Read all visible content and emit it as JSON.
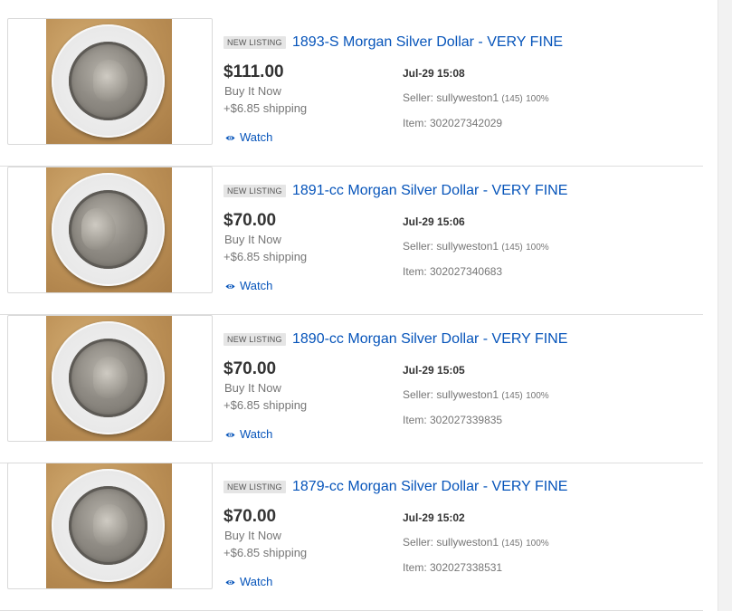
{
  "colors": {
    "link": "#0654ba",
    "price": "#333333",
    "muted": "#767676",
    "badge_bg": "#e5e5e5"
  },
  "watch_icon": "eye-icon",
  "listings": [
    {
      "badge": "NEW LISTING",
      "title": "1893-S Morgan Silver Dollar - VERY FINE",
      "price": "$111.00",
      "buy_type": "Buy It Now",
      "shipping": "+$6.85 shipping",
      "watch": "Watch",
      "date": "Jul-29 15:08",
      "seller_label": "Seller: sullyweston1",
      "seller_feedback": "(145)",
      "seller_percent": "100%",
      "item": "Item: 302027342029"
    },
    {
      "badge": "NEW LISTING",
      "title": "1891-cc Morgan Silver Dollar - VERY FINE",
      "price": "$70.00",
      "buy_type": "Buy It Now",
      "shipping": "+$6.85 shipping",
      "watch": "Watch",
      "date": "Jul-29 15:06",
      "seller_label": "Seller: sullyweston1",
      "seller_feedback": "(145)",
      "seller_percent": "100%",
      "item": "Item: 302027340683"
    },
    {
      "badge": "NEW LISTING",
      "title": "1890-cc Morgan Silver Dollar - VERY FINE",
      "price": "$70.00",
      "buy_type": "Buy It Now",
      "shipping": "+$6.85 shipping",
      "watch": "Watch",
      "date": "Jul-29 15:05",
      "seller_label": "Seller: sullyweston1",
      "seller_feedback": "(145)",
      "seller_percent": "100%",
      "item": "Item: 302027339835"
    },
    {
      "badge": "NEW LISTING",
      "title": "1879-cc Morgan Silver Dollar - VERY FINE",
      "price": "$70.00",
      "buy_type": "Buy It Now",
      "shipping": "+$6.85 shipping",
      "watch": "Watch",
      "date": "Jul-29 15:02",
      "seller_label": "Seller: sullyweston1",
      "seller_feedback": "(145)",
      "seller_percent": "100%",
      "item": "Item: 302027338531"
    }
  ]
}
